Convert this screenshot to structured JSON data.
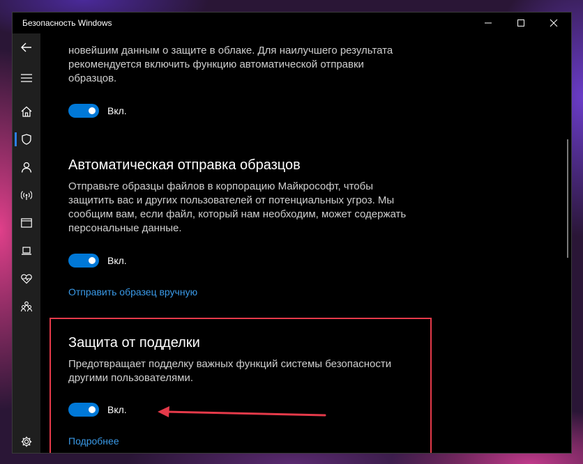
{
  "window": {
    "title": "Безопасность Windows"
  },
  "sidebar": {
    "items": [
      {
        "name": "back-icon"
      },
      {
        "name": "menu-icon"
      },
      {
        "name": "home-icon"
      },
      {
        "name": "shield-icon",
        "active": true
      },
      {
        "name": "account-icon"
      },
      {
        "name": "network-icon"
      },
      {
        "name": "app-browser-icon"
      },
      {
        "name": "device-security-icon"
      },
      {
        "name": "health-icon"
      },
      {
        "name": "family-icon"
      },
      {
        "name": "settings-icon"
      }
    ]
  },
  "sections": {
    "cloud": {
      "desc_lines": [
        "новейшим данным о защите в облаке. Для наилучшего результата",
        "рекомендуется включить функцию автоматической отправки",
        "образцов."
      ],
      "toggle_label": "Вкл."
    },
    "sample": {
      "title": "Автоматическая отправка образцов",
      "desc_lines": [
        "Отправьте образцы файлов в корпорацию Майкрософт, чтобы",
        "защитить вас и других пользователей от потенциальных угроз. Мы",
        "сообщим вам, если файл, который нам необходим, может содержать",
        "персональные данные."
      ],
      "toggle_label": "Вкл.",
      "link": "Отправить образец вручную"
    },
    "tamper": {
      "title": "Защита от подделки",
      "desc_lines": [
        "Предотвращает подделку важных функций системы безопасности",
        "другими пользователями."
      ],
      "toggle_label": "Вкл.",
      "link": "Подробнее"
    }
  },
  "colors": {
    "accent": "#0078d7",
    "link": "#3a9ae8",
    "annotation": "#e53a4a"
  }
}
